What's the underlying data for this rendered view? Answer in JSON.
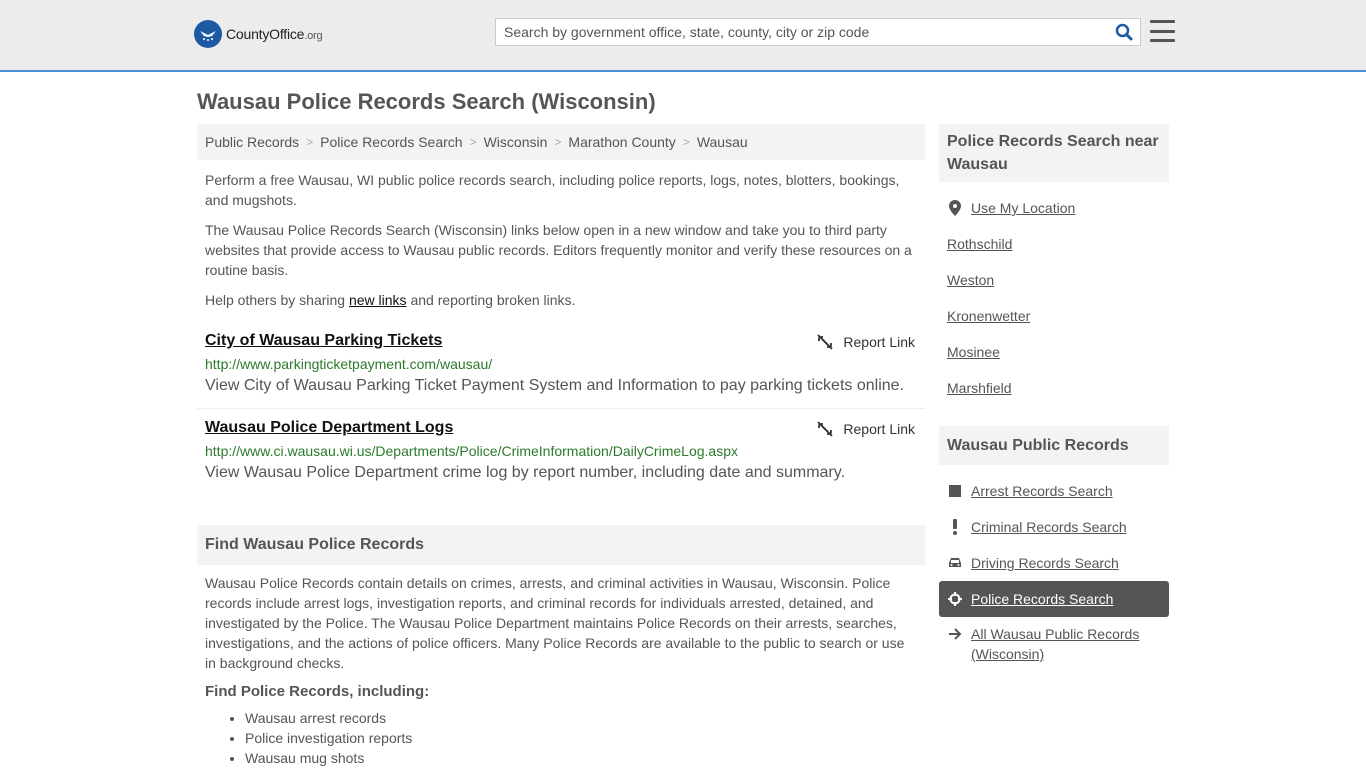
{
  "header": {
    "logo_main": "CountyOffice",
    "logo_tld": ".org",
    "search_placeholder": "Search by government office, state, county, city or zip code"
  },
  "page_title": "Wausau Police Records Search (Wisconsin)",
  "breadcrumb": [
    "Public Records",
    "Police Records Search",
    "Wisconsin",
    "Marathon County",
    "Wausau"
  ],
  "intro": {
    "p1": "Perform a free Wausau, WI public police records search, including police reports, logs, notes, blotters, bookings, and mugshots.",
    "p2": "The Wausau Police Records Search (Wisconsin) links below open in a new window and take you to third party websites that provide access to Wausau public records. Editors frequently monitor and verify these resources on a routine basis.",
    "p3_before": "Help others by sharing ",
    "p3_link": "new links",
    "p3_after": " and reporting broken links."
  },
  "links": [
    {
      "title": "City of Wausau Parking Tickets",
      "url": "http://www.parkingticketpayment.com/wausau/",
      "desc": "View City of Wausau Parking Ticket Payment System and Information to pay parking tickets online.",
      "report": "Report Link"
    },
    {
      "title": "Wausau Police Department Logs",
      "url": "http://www.ci.wausau.wi.us/Departments/Police/CrimeInformation/DailyCrimeLog.aspx",
      "desc": "View Wausau Police Department crime log by report number, including date and summary.",
      "report": "Report Link"
    }
  ],
  "find": {
    "heading": "Find Wausau Police Records",
    "body": "Wausau Police Records contain details on crimes, arrests, and criminal activities in Wausau, Wisconsin. Police records include arrest logs, investigation reports, and criminal records for individuals arrested, detained, and investigated by the Police. The Wausau Police Department maintains Police Records on their arrests, searches, investigations, and the actions of police officers. Many Police Records are available to the public to search or use in background checks.",
    "subheading": "Find Police Records, including:",
    "items": [
      "Wausau arrest records",
      "Police investigation reports",
      "Wausau mug shots"
    ]
  },
  "sidebar": {
    "near_heading": "Police Records Search near Wausau",
    "near_items": [
      "Use My Location",
      "Rothschild",
      "Weston",
      "Kronenwetter",
      "Mosinee",
      "Marshfield"
    ],
    "records_heading": "Wausau Public Records",
    "records_items": [
      "Arrest Records Search",
      "Criminal Records Search",
      "Driving Records Search",
      "Police Records Search",
      "All Wausau Public Records (Wisconsin)"
    ]
  },
  "colors": {
    "accent": "#4a8fce",
    "link_url": "#2b7a2b",
    "active_bg": "#555555"
  }
}
